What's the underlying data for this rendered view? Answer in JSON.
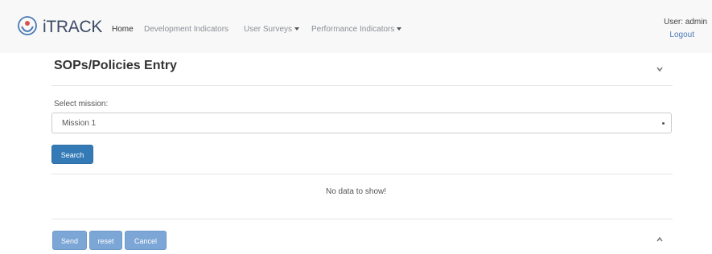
{
  "header": {
    "brand": "iTRACK",
    "nav": {
      "home": "Home",
      "development": "Development Indicators",
      "surveys": "User Surveys",
      "performance": "Performance Indicators"
    },
    "user": "User: admin",
    "logout": "Logout"
  },
  "panel": {
    "title": "SOPs/Policies Entry",
    "select_label": "Select mission:",
    "select_value": "Mission 1",
    "search_label": "Search",
    "empty_message": "No data to show!"
  },
  "footer": {
    "send_label": "Send",
    "reset_label": "reset",
    "cancel_label": "Cancel"
  },
  "colors": {
    "primary": "#337ab7",
    "primary_disabled": "#7ba6d6",
    "navbar_bg": "#f8f8f8"
  },
  "icons": [
    "logo-icon",
    "chevron-down-icon",
    "chevron-up-icon",
    "dropdown-caret-icon"
  ]
}
